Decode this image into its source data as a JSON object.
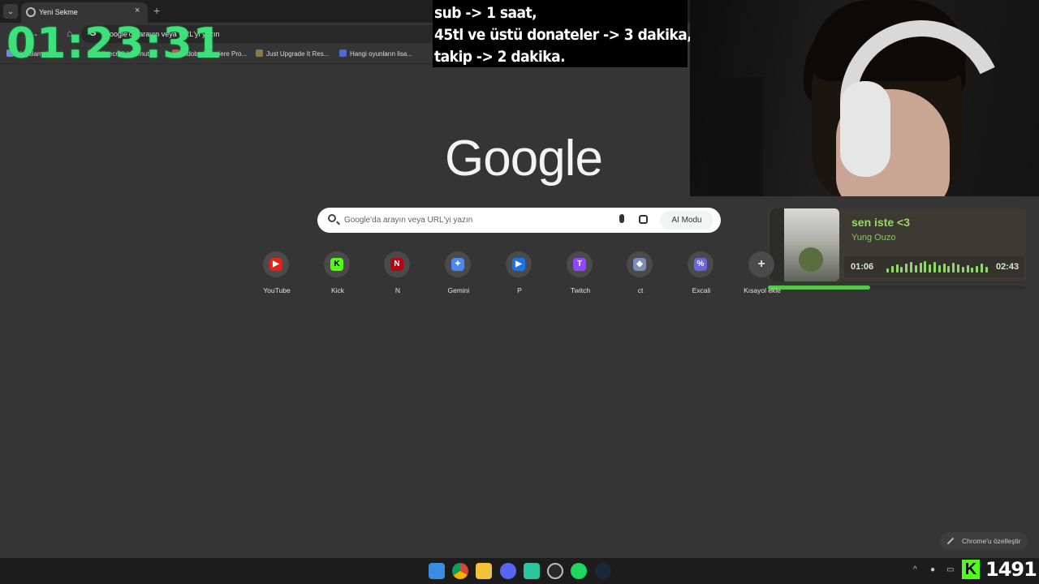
{
  "browser": {
    "tab_title": "Yeni Sekme",
    "omnibox_text": "Google'da arayın veya URL'yi yazın",
    "bookmarks": [
      "Uygulamalar",
      "Minecraft | Komut...",
      "Adobe Premiere Pro...",
      "Just Upgrade It Res...",
      "Hangi oyunların lisa..."
    ]
  },
  "overlay": {
    "timer": "01:23:31",
    "rules": [
      "sub -> 1 saat,",
      "45tl ve üstü donateler -> 3 dakika,",
      "takip -> 2 dakika."
    ]
  },
  "player": {
    "song": "sen iste <3",
    "artist": "Yung Ouzo",
    "current_time": "01:06",
    "total_time": "02:43",
    "progress": 0.4,
    "accent": "#9bd86a"
  },
  "newtab": {
    "logo": "Google",
    "search_placeholder": "Google'da arayın veya URL'yi yazın",
    "ai_mode_label": "AI Modu",
    "shortcuts": [
      {
        "label": "YouTube",
        "icon": "youtube-icon",
        "color": "#e62117",
        "glyph": "▶"
      },
      {
        "label": "Kick",
        "icon": "kick-icon",
        "color": "#53fc18",
        "glyph": "K"
      },
      {
        "label": "N",
        "icon": "netflix-icon",
        "color": "#b20710",
        "glyph": "N"
      },
      {
        "label": "Gemini",
        "icon": "gemini-icon",
        "color": "#4a86f7",
        "glyph": "✦"
      },
      {
        "label": "P",
        "icon": "p-icon",
        "color": "#1a73e8",
        "glyph": "▶"
      },
      {
        "label": "Twitch",
        "icon": "twitch-icon",
        "color": "#9146ff",
        "glyph": "T"
      },
      {
        "label": "ct",
        "icon": "ct-icon",
        "color": "#7b8cb8",
        "glyph": "◆"
      },
      {
        "label": "Excali",
        "icon": "excalidraw-icon",
        "color": "#6965db",
        "glyph": "%"
      },
      {
        "label": "Kısayol ekle",
        "icon": "add-shortcut-icon",
        "color": "#4a4a4a",
        "glyph": "+"
      }
    ],
    "customize_label": "Chrome'u özelleştir"
  },
  "taskbar": {
    "apps": [
      "windows-start-icon",
      "chrome-icon",
      "file-explorer-icon",
      "discord-icon",
      "app-icon",
      "obs-icon",
      "spotify-icon",
      "steam-icon"
    ],
    "kick_followers": "1491"
  }
}
